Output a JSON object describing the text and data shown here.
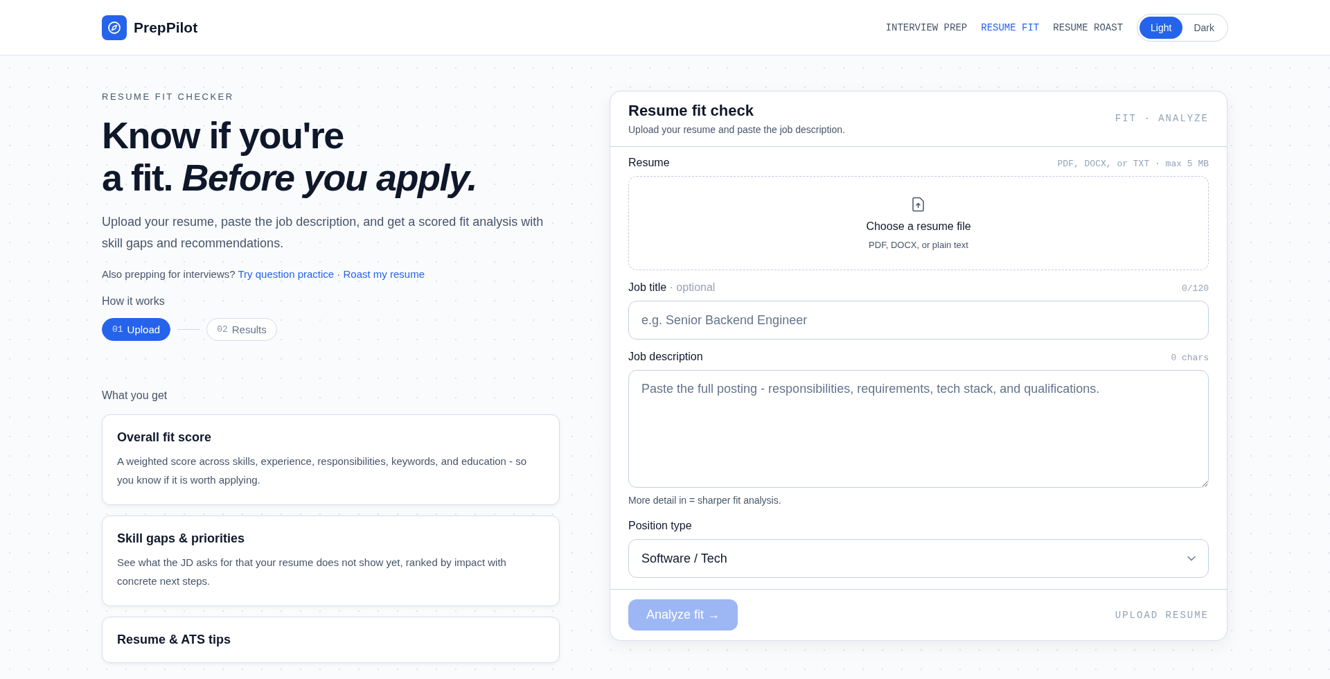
{
  "brand": {
    "name": "PrepPilot"
  },
  "nav": [
    {
      "label": "INTERVIEW PREP",
      "selected": false
    },
    {
      "label": "RESUME FIT",
      "selected": true
    },
    {
      "label": "RESUME ROAST",
      "selected": false
    }
  ],
  "theme_toggle": [
    {
      "label": "Light",
      "selected": true
    },
    {
      "label": "Dark",
      "selected": false
    }
  ],
  "hero": {
    "eyebrow": "RESUME FIT CHECKER",
    "headline_line1": "Know if you're",
    "headline_line2": "a fit. *Before you apply.*",
    "intro": "Upload your resume, paste the job description, and get a scored fit analysis with skill gaps and recommendations.",
    "also_text": "Also prepping for interviews?",
    "links": [
      "Try question practice",
      "Roast my resume"
    ],
    "link_separator": "·"
  },
  "how_it_works": {
    "title": "How it works",
    "steps": [
      {
        "number": "01",
        "label": "Upload",
        "selected": true
      },
      {
        "number": "02",
        "label": "Results",
        "selected": false
      }
    ]
  },
  "what_you_get": {
    "title": "What you get",
    "cards": [
      {
        "title": "Overall fit score",
        "text": "A weighted score across skills, experience, responsibilities, keywords, and education - so you know if it is worth applying."
      },
      {
        "title": "Skill gaps & priorities",
        "text": "See what the JD asks for that your resume does not show yet, ranked by impact with concrete next steps."
      },
      {
        "title": "Resume & ATS tips"
      }
    ]
  },
  "form": {
    "title": "Resume fit check",
    "subtitle": "Upload your resume and paste the job description.",
    "tag": "FIT · ANALYZE",
    "resume": {
      "label": "Resume",
      "hint": "PDF, DOCX, or TXT · max 5 MB",
      "drop_title": "Choose a resume file",
      "drop_sub": "PDF, DOCX, or plain text"
    },
    "job_title": {
      "label": "Job title",
      "optional": "· optional",
      "counter": "0/120",
      "placeholder": "e.g. Senior Backend Engineer"
    },
    "job_description": {
      "label": "Job description",
      "counter": "0 chars",
      "placeholder": "Paste the full posting - responsibilities, requirements, tech stack, and qualifications.",
      "help": "More detail in = sharper fit analysis."
    },
    "position_type": {
      "label": "Position type",
      "value": "Software / Tech"
    },
    "submit": {
      "label": "Analyze fit →",
      "disabled": true
    },
    "footer_tag": "UPLOAD RESUME"
  }
}
